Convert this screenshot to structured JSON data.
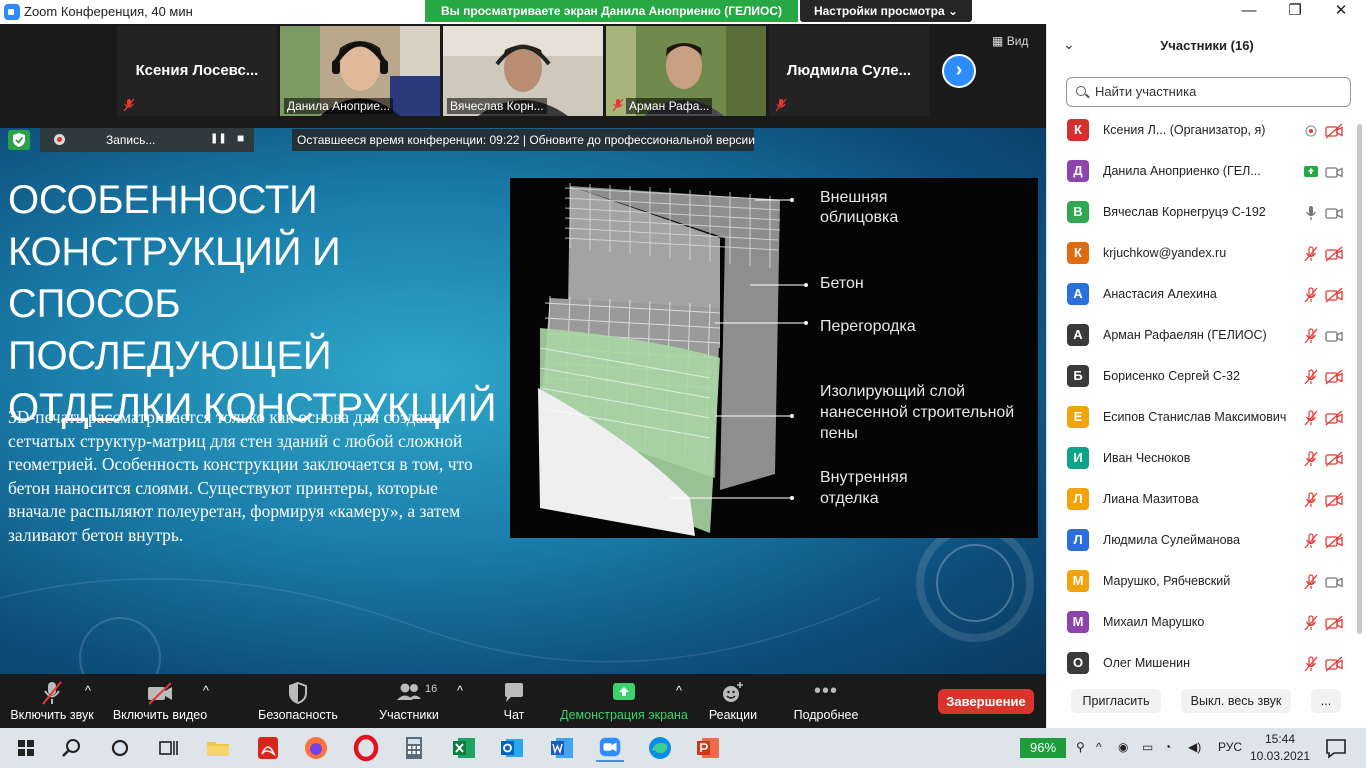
{
  "window": {
    "title": "Zoom Конференция, 40 мин",
    "minimize": "—",
    "restore": "❐",
    "close": "✕"
  },
  "share_banner": "Вы просматриваете экран Данила Аноприенко  (ГЕЛИОС)",
  "view_options": "Настройки просмотра ⌄",
  "video_strip": {
    "view_label": "Вид",
    "tiles": [
      {
        "name": "Ксения  Лосевс...",
        "video": false
      },
      {
        "name": "Данила Аноприе...",
        "video": true,
        "active": true
      },
      {
        "name": "Вячеслав Корн...",
        "video": true
      },
      {
        "name": "Арман Рафа...",
        "video": true
      },
      {
        "name": "Людмила  Суле...",
        "video": false
      }
    ]
  },
  "recording": {
    "label": "Запись...",
    "pause": "❚❚",
    "stop": "■"
  },
  "timer_banner": "Оставшееся время конференции: 09:22 | Обновите до профессиональной версии",
  "slide": {
    "title": "ОСОБЕННОСТИ КОНСТРУКЦИЙ И СПОСОБ ПОСЛЕДУЮЩЕЙ ОТДЕЛКИ КОНСТРУКЦИЙ",
    "body": "3D-печать рассматривается только как основа для создания сетчатых структур-матриц для стен зданий с любой сложной геометрией. Особенность конструкции заключается в том, что бетон наносится слоями. Существуют принтеры, которые вначале распыляют полеуретан, формируя «камеру», а затем заливают бетон внутрь.",
    "image_labels": {
      "l1a": "Внешняя",
      "l1b": "облицовка",
      "l2": "Бетон",
      "l3": "Перегородка",
      "l4a": "Изолирующий слой",
      "l4b": "нанесенной строительной",
      "l4c": "пены",
      "l5a": "Внутренняя",
      "l5b": "отделка"
    }
  },
  "toolbar": {
    "audio": "Включить звук",
    "video": "Включить видео",
    "security": "Безопасность",
    "participants": "Участники",
    "participants_count": "16",
    "chat": "Чат",
    "share": "Демонстрация экрана",
    "reactions": "Реакции",
    "more": "Подробнее",
    "end": "Завершение",
    "caret": "^"
  },
  "participants_panel": {
    "title": "Участники (16)",
    "search_placeholder": "Найти участника",
    "list": [
      {
        "initial": "К",
        "color": "#d32f2f",
        "name": "Ксения Л...  (Организатор, я)",
        "a": "rec",
        "b": "video-off"
      },
      {
        "initial": "Д",
        "color": "#8e44ad",
        "name": "Данила Аноприенко  (ГЕЛ...",
        "a": "share",
        "b": "video"
      },
      {
        "initial": "В",
        "color": "#2fa84f",
        "name": "Вячеслав Корнегруцэ С-192",
        "a": "mic",
        "b": "video"
      },
      {
        "initial": "К",
        "color": "#e06a0e",
        "name": "krjuchkow@yandex.ru",
        "a": "mic-off",
        "b": "video-off"
      },
      {
        "initial": "А",
        "color": "#2a6fdb",
        "name": "Анастасия Алехина",
        "a": "mic-off",
        "b": "video-off"
      },
      {
        "initial": "А",
        "color": "#3a3a3a",
        "name": "Арман Рафаелян (ГЕЛИОС)",
        "a": "mic-off",
        "b": "video"
      },
      {
        "initial": "Б",
        "color": "#3a3a3a",
        "name": "Борисенко Сергей С-32",
        "a": "mic-off",
        "b": "video-off"
      },
      {
        "initial": "Е",
        "color": "#f0a30a",
        "name": "Есипов Станислав Максимович",
        "a": "mic-off",
        "b": "video-off"
      },
      {
        "initial": "И",
        "color": "#0fa38a",
        "name": "Иван Чесноков",
        "a": "mic-off",
        "b": "video-off"
      },
      {
        "initial": "Л",
        "color": "#f0a30a",
        "name": "Лиана Мазитова",
        "a": "mic-off",
        "b": "video-off"
      },
      {
        "initial": "Л",
        "color": "#2a6fdb",
        "name": "Людмила Сулейманова",
        "a": "mic-off",
        "b": "video-off"
      },
      {
        "initial": "М",
        "color": "#f0a30a",
        "name": "Марушко, Рябчевский",
        "a": "mic-off",
        "b": "video"
      },
      {
        "initial": "М",
        "color": "#8e44ad",
        "name": "Михаил Марушко",
        "a": "mic-off",
        "b": "video-off"
      },
      {
        "initial": "О",
        "color": "#3a3a3a",
        "name": "Олег Мишенин",
        "a": "mic-off",
        "b": "video-off"
      }
    ],
    "invite": "Пригласить",
    "mute_all": "Выкл. весь звук",
    "more": "..."
  },
  "taskbar": {
    "battery": "96%",
    "lang": "РУС",
    "time": "15:44",
    "date": "10.03.2021"
  },
  "colors": {
    "accent": "#2d8cff",
    "share_green": "#27a844",
    "end_red": "#d9342b",
    "active_speaker": "#e6d52a"
  }
}
